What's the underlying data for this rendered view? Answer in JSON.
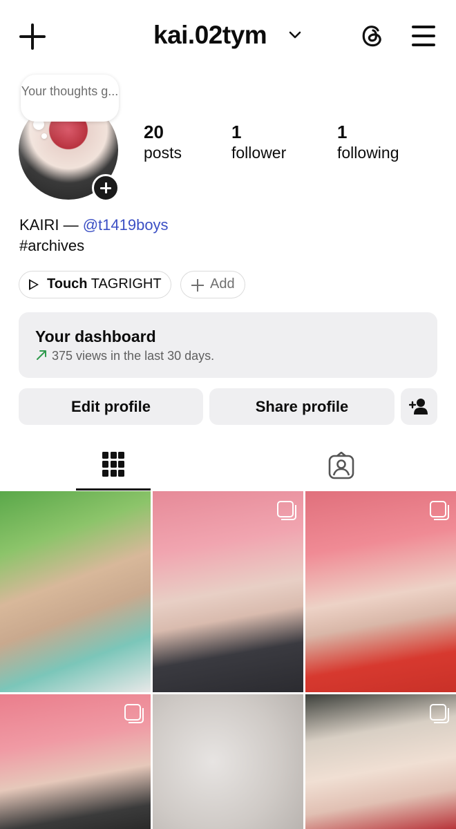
{
  "header": {
    "username": "kai.02tym"
  },
  "note": {
    "text": "Your thoughts g..."
  },
  "stats": [
    {
      "value": "20",
      "label": "posts"
    },
    {
      "value": "1",
      "label": "follower"
    },
    {
      "value": "1",
      "label": "following"
    }
  ],
  "bio": {
    "name": "KAIRI —",
    "mention": "@t1419boys",
    "line2": "#archives"
  },
  "links": {
    "primary_bold": "Touch",
    "primary_rest": "TAGRIGHT",
    "add": "Add"
  },
  "dashboard": {
    "title": "Your dashboard",
    "subtitle": "375 views in the last 30 days."
  },
  "buttons": {
    "edit": "Edit profile",
    "share": "Share profile"
  },
  "colors": {
    "mention": "#3b4fc4",
    "button_bg": "#efeff1",
    "trend_green": "#2e9a4c"
  },
  "icons": [
    "add-icon",
    "chevron-down-icon",
    "threads-icon",
    "menu-icon",
    "play-icon",
    "add-person-icon",
    "grid-icon",
    "tagged-icon",
    "multiple-photos-icon"
  ]
}
